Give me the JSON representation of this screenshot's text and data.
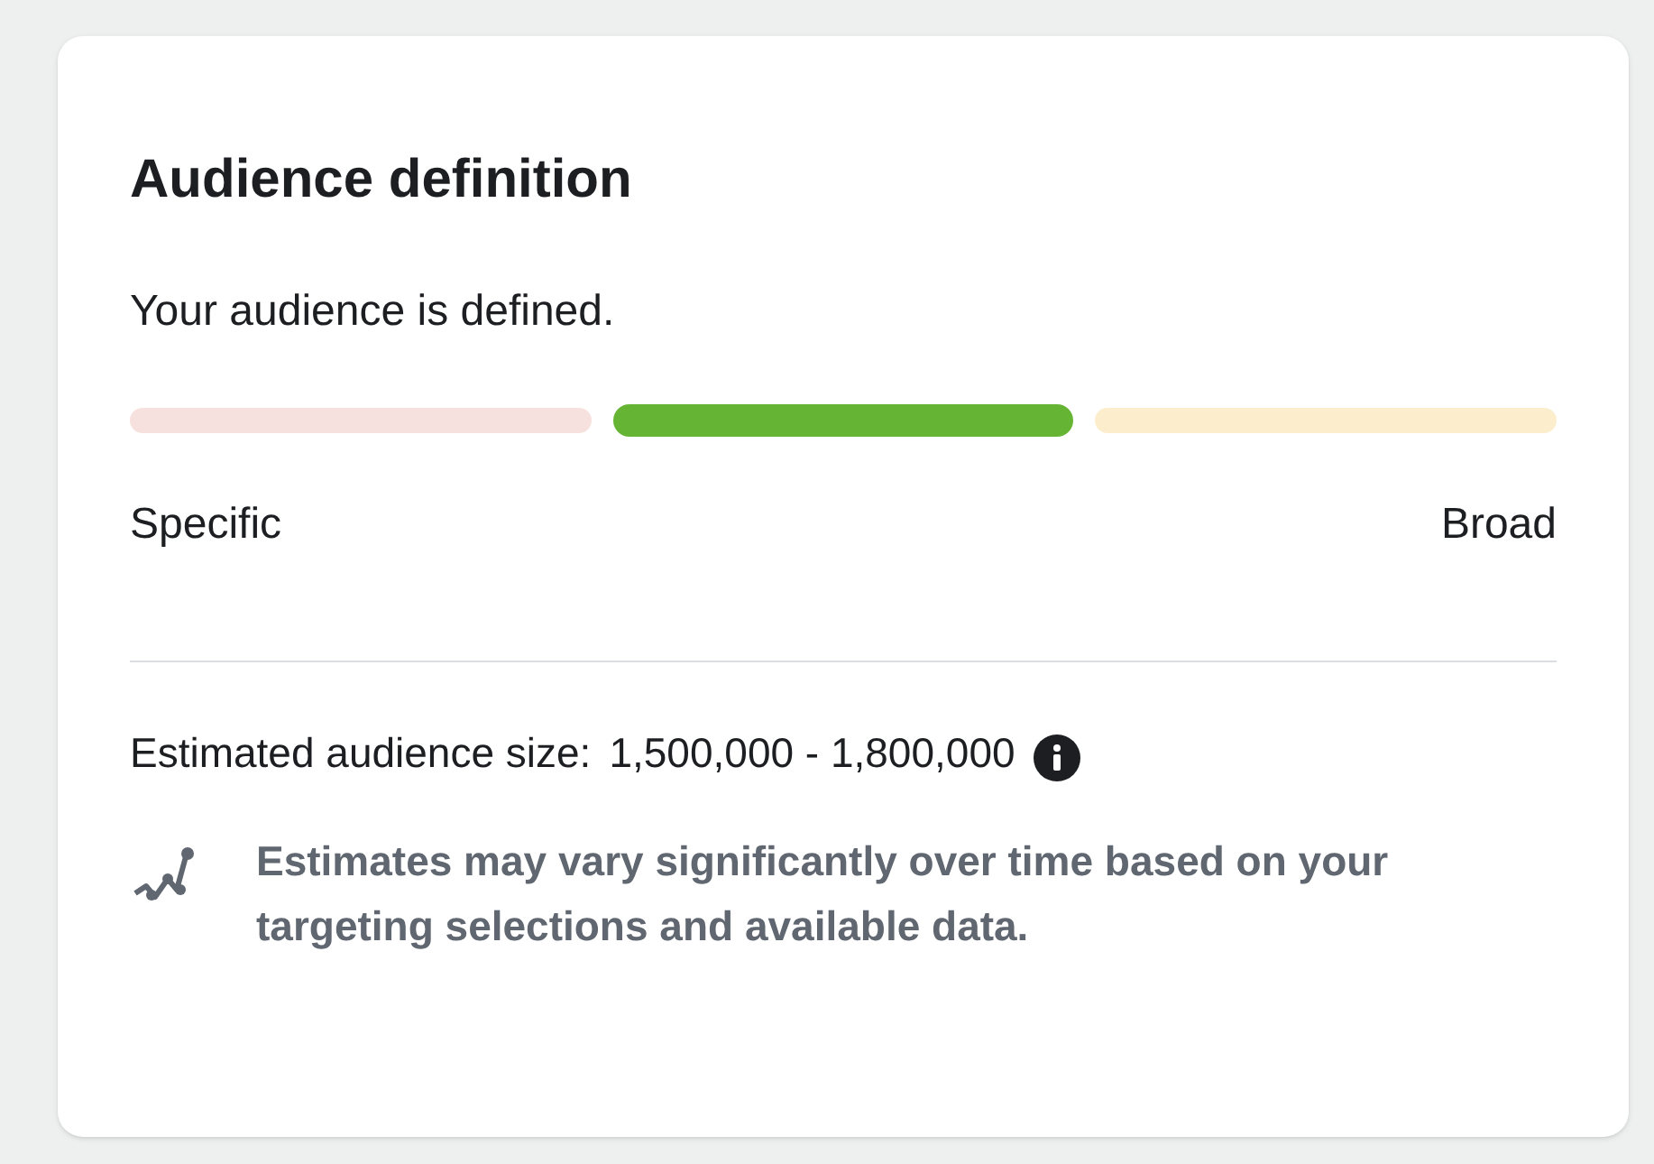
{
  "card": {
    "title": "Audience definition",
    "status": "Your audience is defined.",
    "meter": {
      "segments": [
        {
          "color": "#f7e1df",
          "selected": false
        },
        {
          "color": "#66b433",
          "selected": true
        },
        {
          "color": "#fcedcc",
          "selected": false
        }
      ],
      "left_label": "Specific",
      "right_label": "Broad"
    },
    "estimate": {
      "label": "Estimated audience size:",
      "value": "1,500,000 - 1,800,000"
    },
    "note": "Estimates may vary significantly over time based on your targeting selections and available data."
  }
}
